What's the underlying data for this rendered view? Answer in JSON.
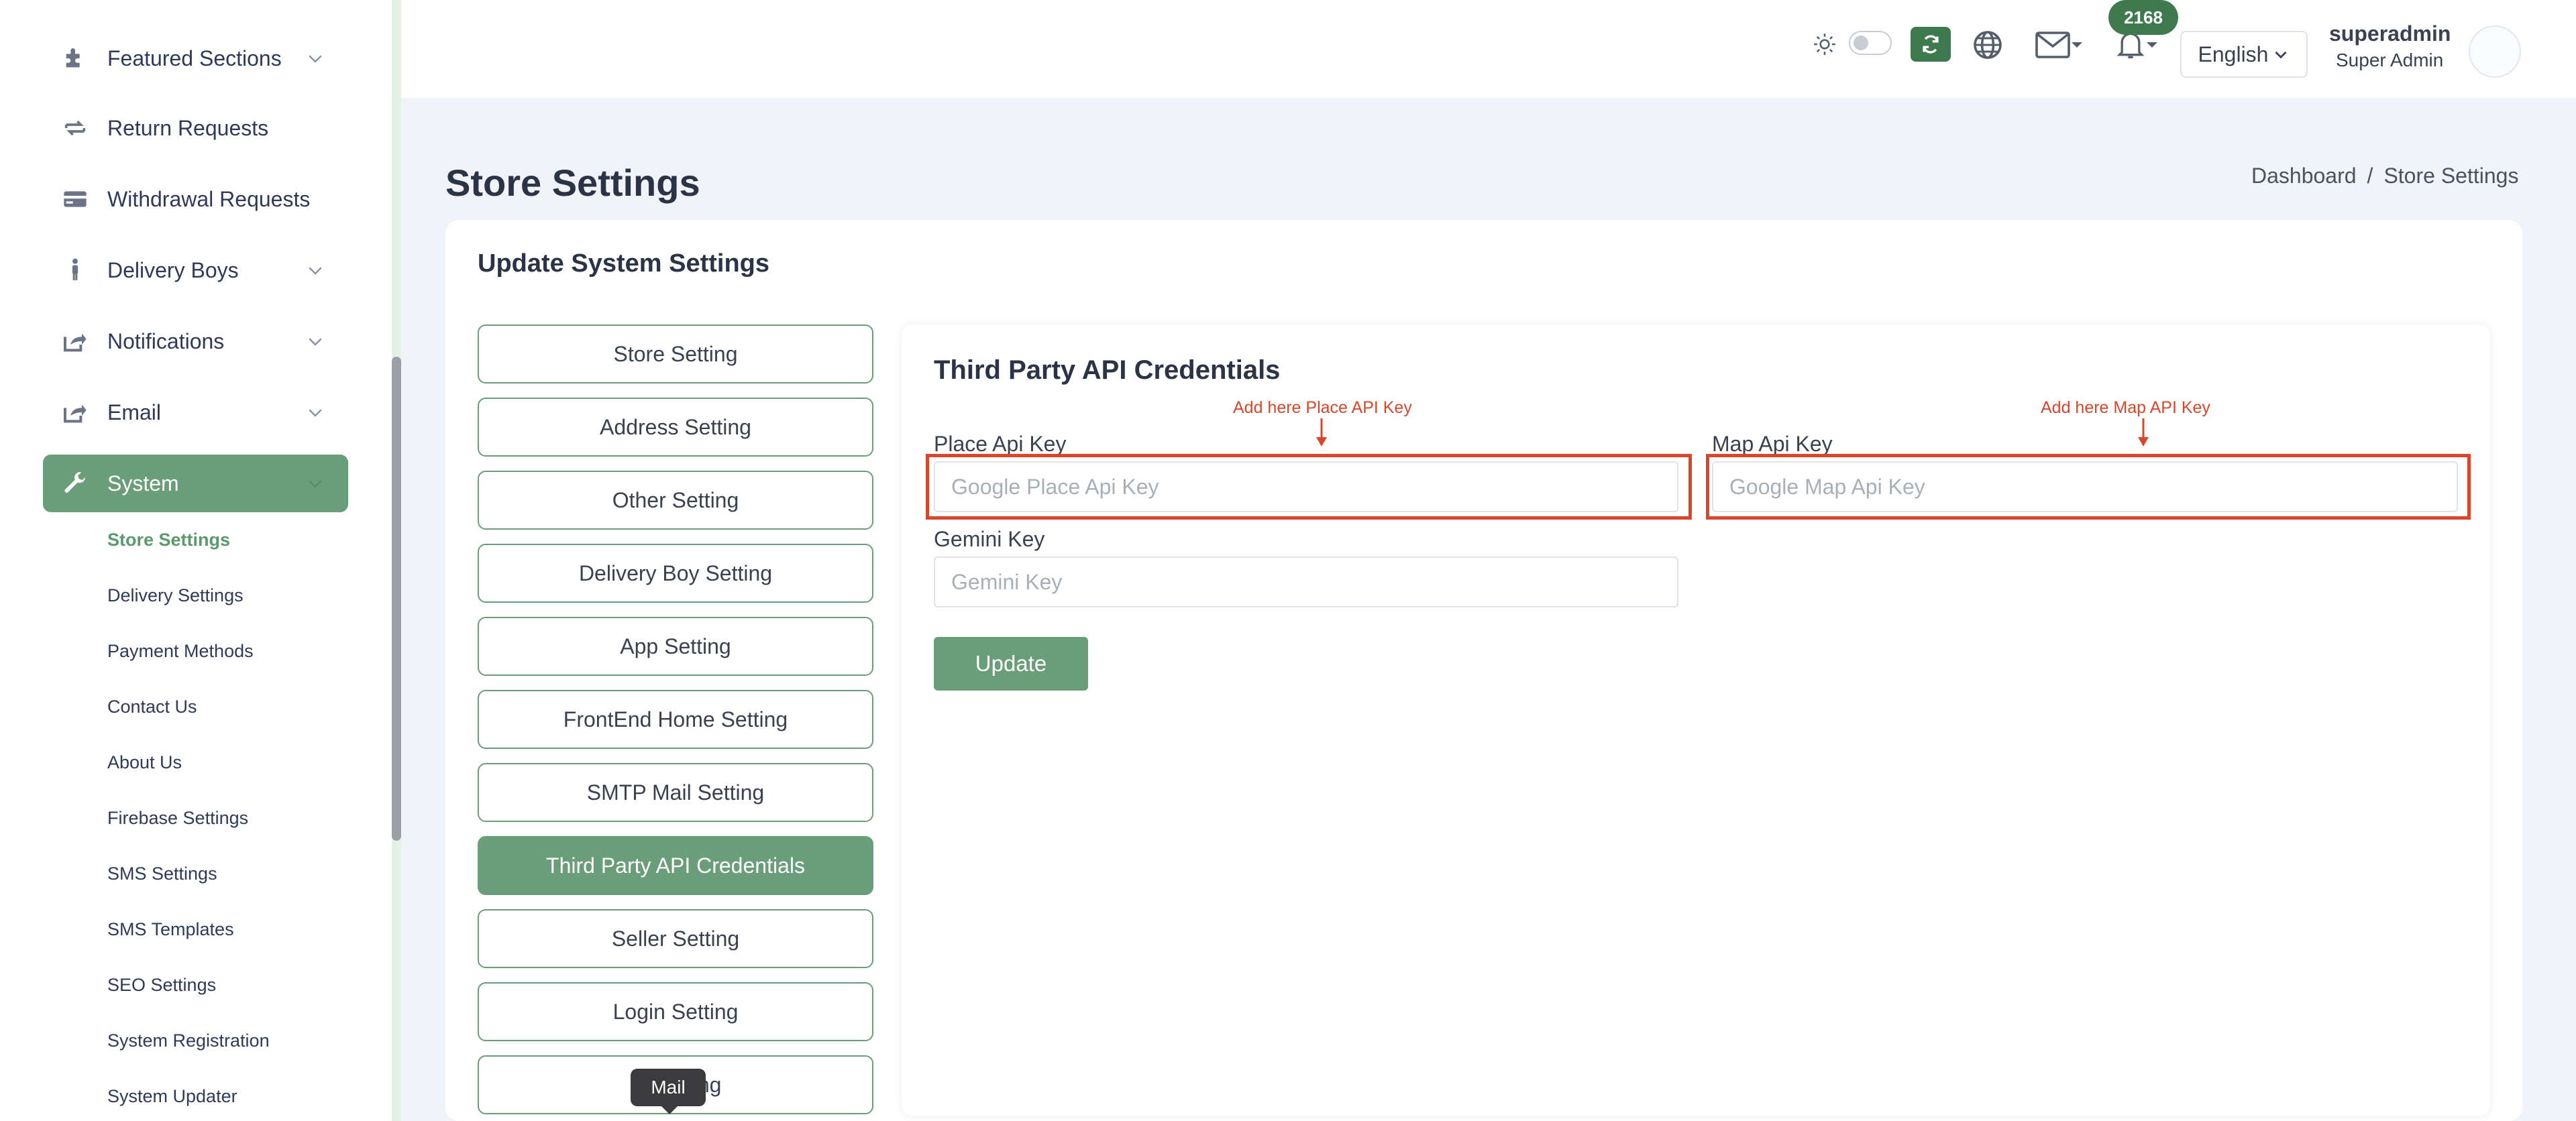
{
  "sidebar": {
    "items": [
      {
        "label": "Featured Sections",
        "icon": "puzzle-icon",
        "has_chevron": true
      },
      {
        "label": "Return Requests",
        "icon": "return-icon",
        "has_chevron": false
      },
      {
        "label": "Withdrawal Requests",
        "icon": "card-icon",
        "has_chevron": false
      },
      {
        "label": "Delivery Boys",
        "icon": "person-icon",
        "has_chevron": true
      },
      {
        "label": "Notifications",
        "icon": "share-icon",
        "has_chevron": true
      },
      {
        "label": "Email",
        "icon": "share-icon",
        "has_chevron": true
      },
      {
        "label": "System",
        "icon": "wrench-icon",
        "has_chevron": true,
        "active": true
      }
    ],
    "sub_items": [
      {
        "label": "Store Settings",
        "active": true
      },
      {
        "label": "Delivery Settings"
      },
      {
        "label": "Payment Methods"
      },
      {
        "label": "Contact Us"
      },
      {
        "label": "About Us"
      },
      {
        "label": "Firebase Settings"
      },
      {
        "label": "SMS Settings"
      },
      {
        "label": "SMS Templates"
      },
      {
        "label": "SEO Settings"
      },
      {
        "label": "System Registration"
      },
      {
        "label": "System Updater"
      }
    ]
  },
  "header": {
    "notification_count": "2168",
    "language": "English",
    "user_name": "superadmin",
    "user_role": "Super Admin"
  },
  "page": {
    "title": "Store Settings",
    "breadcrumb": [
      "Dashboard",
      "/",
      "Store Settings"
    ]
  },
  "card": {
    "title": "Update System Settings",
    "tabs": [
      {
        "label": "Store Setting"
      },
      {
        "label": "Address Setting"
      },
      {
        "label": "Other Setting"
      },
      {
        "label": "Delivery Boy Setting"
      },
      {
        "label": "App Setting"
      },
      {
        "label": "FrontEnd Home Setting"
      },
      {
        "label": "SMTP Mail Setting"
      },
      {
        "label": "Third Party API Credentials",
        "active": true
      },
      {
        "label": "Seller Setting"
      },
      {
        "label": "Login Setting"
      },
      {
        "label": "C        ing"
      }
    ]
  },
  "form": {
    "section_title": "Third Party API Credentials",
    "place_api_label": "Place Api Key",
    "place_api_placeholder": "Google Place Api Key",
    "place_api_value": "",
    "map_api_label": "Map Api Key",
    "map_api_placeholder": "Google Map Api Key",
    "map_api_value": "",
    "gemini_label": "Gemini Key",
    "gemini_placeholder": "Gemini Key",
    "gemini_value": "",
    "update_label": "Update",
    "annotation_place": "Add here Place API Key",
    "annotation_map": "Add here Map API Key"
  },
  "tooltip": {
    "text": "Mail"
  },
  "colors": {
    "accent": "#6a9e7a",
    "badge": "#3e7a4e",
    "annotation": "#d9462a"
  }
}
